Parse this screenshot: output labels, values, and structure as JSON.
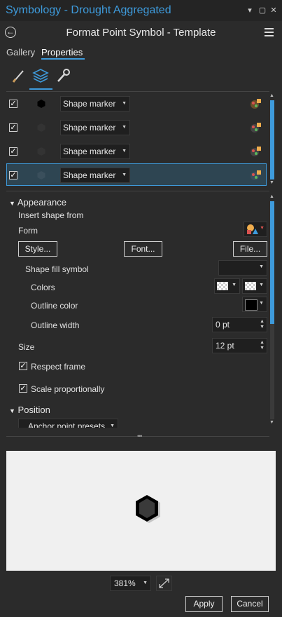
{
  "window": {
    "title": "Symbology - Drought Aggregated"
  },
  "header": {
    "title": "Format Point Symbol - Template"
  },
  "tabs": {
    "gallery": "Gallery",
    "properties": "Properties"
  },
  "layers": [
    {
      "checked": true,
      "type": "Shape marker"
    },
    {
      "checked": true,
      "type": "Shape marker"
    },
    {
      "checked": true,
      "type": "Shape marker"
    },
    {
      "checked": true,
      "type": "Shape marker"
    }
  ],
  "appearance": {
    "heading": "Appearance",
    "insert_shape_from": "Insert shape from",
    "form_label": "Form",
    "style_button": "Style...",
    "font_button": "Font...",
    "file_button": "File...",
    "shape_fill_symbol": "Shape fill symbol",
    "colors_label": "Colors",
    "outline_color_label": "Outline color",
    "outline_width_label": "Outline width",
    "outline_width_value": "0 pt",
    "size_label": "Size",
    "size_value": "12 pt",
    "respect_frame": "Respect frame",
    "scale_proportionally": "Scale proportionally"
  },
  "position": {
    "heading": "Position",
    "anchor_presets": "Anchor point presets"
  },
  "footer": {
    "zoom": "381%",
    "apply": "Apply",
    "cancel": "Cancel"
  },
  "colors": {
    "accent": "#3e9bdc",
    "panel": "#2b2b2b",
    "preview_bg": "#f0f0f0"
  }
}
